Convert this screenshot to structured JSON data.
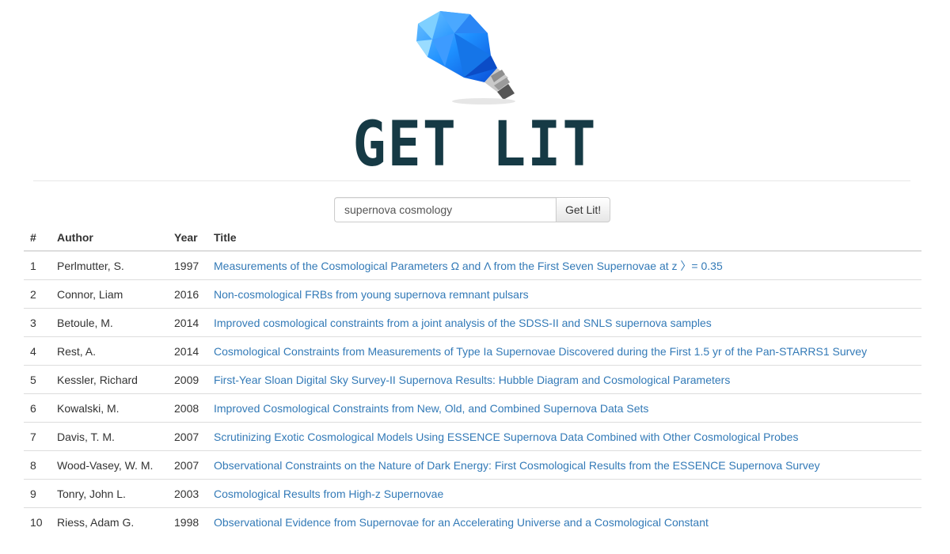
{
  "logo": {
    "text": "GET LIT",
    "icon": "lightbulb-icon",
    "color": "#163a45",
    "bulb_color": "#1e90ff"
  },
  "search": {
    "value": "supernova cosmology",
    "button_label": "Get Lit!"
  },
  "table": {
    "headers": {
      "num": "#",
      "author": "Author",
      "year": "Year",
      "title": "Title"
    },
    "rows": [
      {
        "num": "1",
        "author": "Perlmutter, S.",
        "year": "1997",
        "title": "Measurements of the Cosmological Parameters Ω and Λ from the First Seven Supernovae at z 〉= 0.35"
      },
      {
        "num": "2",
        "author": "Connor, Liam",
        "year": "2016",
        "title": "Non-cosmological FRBs from young supernova remnant pulsars"
      },
      {
        "num": "3",
        "author": "Betoule, M.",
        "year": "2014",
        "title": "Improved cosmological constraints from a joint analysis of the SDSS-II and SNLS supernova samples"
      },
      {
        "num": "4",
        "author": "Rest, A.",
        "year": "2014",
        "title": "Cosmological Constraints from Measurements of Type Ia Supernovae Discovered during the First 1.5 yr of the Pan-STARRS1 Survey"
      },
      {
        "num": "5",
        "author": "Kessler, Richard",
        "year": "2009",
        "title": "First-Year Sloan Digital Sky Survey-II Supernova Results: Hubble Diagram and Cosmological Parameters"
      },
      {
        "num": "6",
        "author": "Kowalski, M.",
        "year": "2008",
        "title": "Improved Cosmological Constraints from New, Old, and Combined Supernova Data Sets"
      },
      {
        "num": "7",
        "author": "Davis, T. M.",
        "year": "2007",
        "title": "Scrutinizing Exotic Cosmological Models Using ESSENCE Supernova Data Combined with Other Cosmological Probes"
      },
      {
        "num": "8",
        "author": "Wood-Vasey, W. M.",
        "year": "2007",
        "title": "Observational Constraints on the Nature of Dark Energy: First Cosmological Results from the ESSENCE Supernova Survey"
      },
      {
        "num": "9",
        "author": "Tonry, John L.",
        "year": "2003",
        "title": "Cosmological Results from High-z Supernovae"
      },
      {
        "num": "10",
        "author": "Riess, Adam G.",
        "year": "1998",
        "title": "Observational Evidence from Supernovae for an Accelerating Universe and a Cosmological Constant"
      }
    ]
  },
  "colors": {
    "link": "#337ab7",
    "text": "#333333",
    "border": "#dddddd"
  }
}
